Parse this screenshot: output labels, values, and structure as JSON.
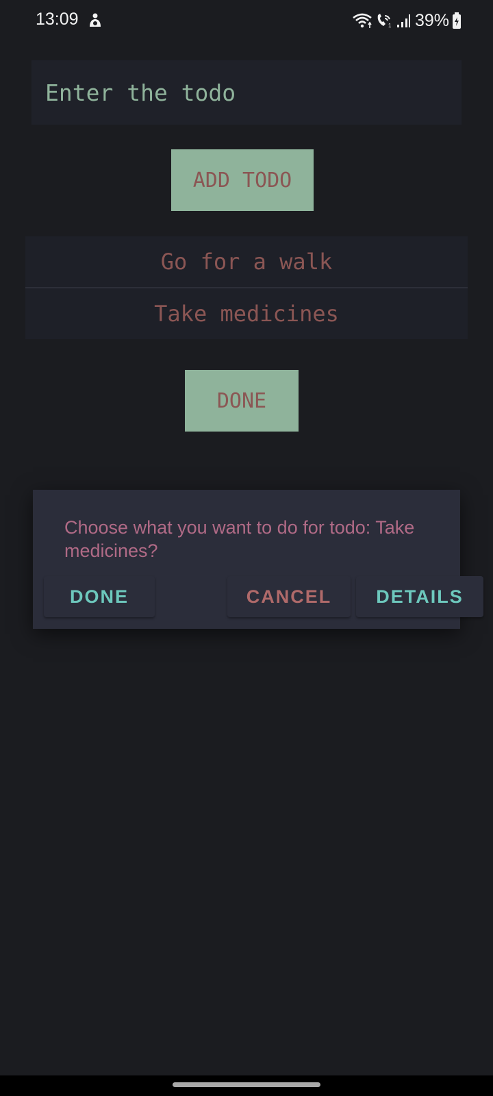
{
  "status_bar": {
    "time": "13:09",
    "battery_percent": "39%",
    "icons": [
      "notification-icon",
      "wifi-icon",
      "wifi-calling-icon",
      "signal-icon",
      "battery-icon"
    ]
  },
  "todo_input": {
    "value": "",
    "placeholder": "Enter the todo"
  },
  "add_button": {
    "label": "ADD TODO"
  },
  "todos": [
    {
      "text": "Go for a walk"
    },
    {
      "text": "Take medicines"
    }
  ],
  "done_button": {
    "label": "DONE"
  },
  "dialog": {
    "message": "Choose what you want to do for todo: Take medicines?",
    "buttons": {
      "done": "DONE",
      "cancel": "CANCEL",
      "details": "DETAILS"
    }
  },
  "colors": {
    "background": "#1b1c20",
    "button_bg": "#8fb39b",
    "button_text": "#8b5654",
    "dialog_bg": "#2b2d3a",
    "dialog_text": "#b06a86",
    "accent": "#6dc8bd"
  }
}
